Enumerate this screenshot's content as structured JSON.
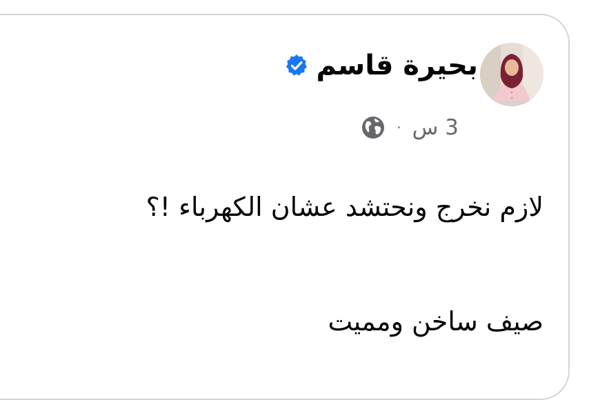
{
  "post": {
    "author_name": "بحيرة قاسم",
    "verified_icon": "verified-badge-icon",
    "timestamp": "3 س",
    "separator": "·",
    "audience_icon": "globe-icon",
    "text_lines": [
      "لازم نخرج ونحتشد عشان الكهرباء !؟",
      "صيف ساخن ومميت"
    ]
  },
  "colors": {
    "verified_blue": "#1877f2",
    "meta_gray": "#65676b",
    "text_black": "#050505",
    "card_border": "#d4d4d7"
  }
}
